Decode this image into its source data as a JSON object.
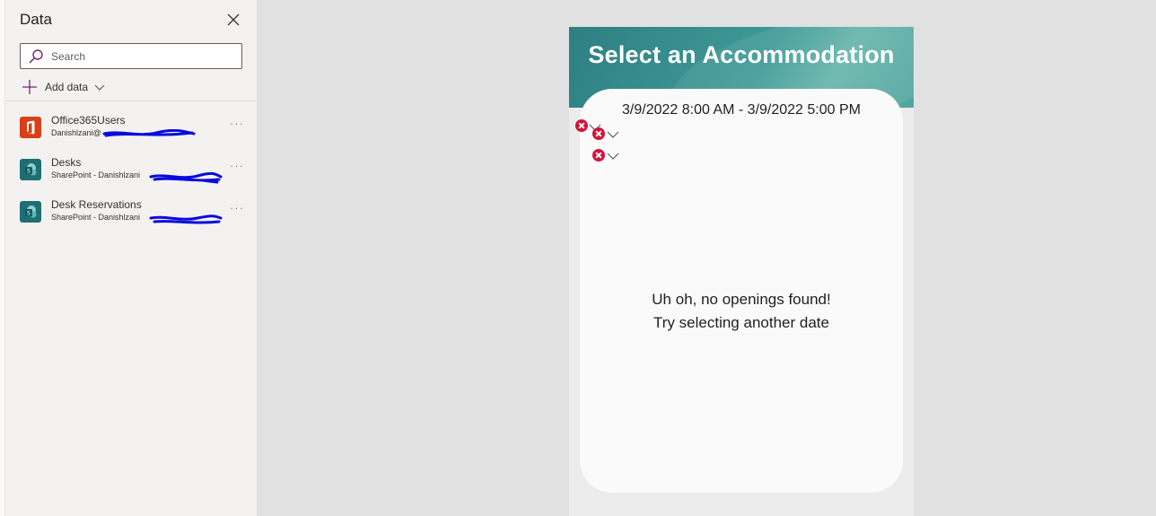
{
  "data_pane": {
    "title": "Data",
    "search": {
      "placeholder": "Search",
      "value": ""
    },
    "add_data_label": "Add data",
    "sources": [
      {
        "name": "Office365Users",
        "subtitle": "Danishlzani@",
        "icon": "office365-icon"
      },
      {
        "name": "Desks",
        "subtitle": "SharePoint - Danishlzani",
        "icon": "sharepoint-icon"
      },
      {
        "name": "Desk Reservations",
        "subtitle": "SharePoint - Danishlzani",
        "icon": "sharepoint-icon"
      }
    ],
    "more_label": "···"
  },
  "app": {
    "title": "Select an Accommodation",
    "date_range": "3/9/2022 8:00 AM - 3/9/2022 5:00 PM",
    "empty_line1": "Uh oh, no openings found!",
    "empty_line2": "Try selecting another date"
  },
  "colors": {
    "header_teal": "#2e7f82",
    "error_red": "#d1153a",
    "office_orange": "#dc3e15",
    "sharepoint_teal": "#1f6e74",
    "redaction_blue": "#0a0adc"
  }
}
